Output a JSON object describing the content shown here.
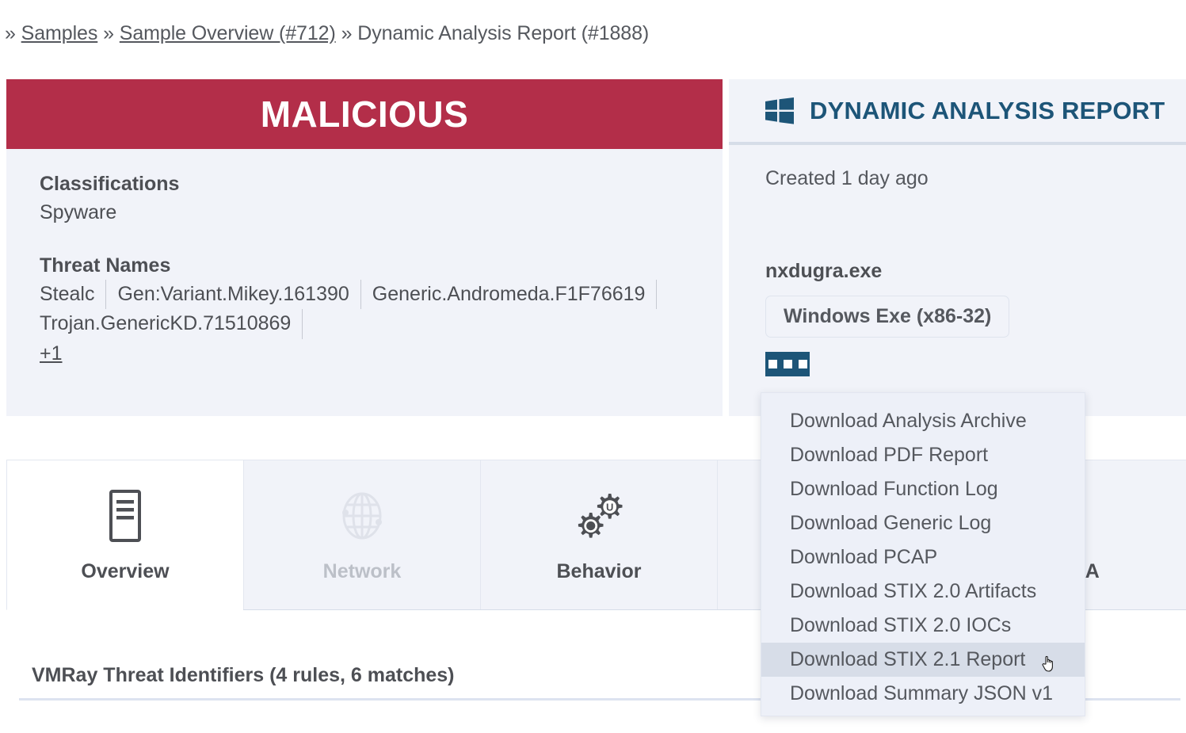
{
  "breadcrumb": {
    "separator": "»",
    "items": [
      {
        "label": "Samples",
        "link": true
      },
      {
        "label": "Sample Overview (#712)",
        "link": true
      },
      {
        "label": "Dynamic Analysis Report (#1888)",
        "link": false
      }
    ]
  },
  "verdict": {
    "banner": "MALICIOUS",
    "banner_color": "#b32e49",
    "classifications_label": "Classifications",
    "classifications_value": "Spyware",
    "threat_names_label": "Threat Names",
    "threat_names": [
      "Stealc",
      "Gen:Variant.Mikey.161390",
      "Generic.Andromeda.F1F76619",
      "Trojan.GenericKD.71510869"
    ],
    "threat_names_more": "+1"
  },
  "report": {
    "icon": "windows-logo-icon",
    "title": "DYNAMIC ANALYSIS REPORT",
    "title_color": "#1d5578",
    "created": "Created 1 day ago",
    "file_name": "nxdugra.exe",
    "file_type_badge": "Windows Exe (x86-32)",
    "more_button": "more-actions-icon"
  },
  "dropdown": {
    "open": true,
    "active_index": 7,
    "items": [
      "Download Analysis Archive",
      "Download PDF Report",
      "Download Function Log",
      "Download Generic Log",
      "Download PCAP",
      "Download STIX 2.0 Artifacts",
      "Download STIX 2.0 IOCs",
      "Download STIX 2.1 Report",
      "Download Summary JSON v1"
    ]
  },
  "tabs": {
    "active_index": 0,
    "items": [
      {
        "label": "Overview",
        "icon": "document-icon",
        "state": "active"
      },
      {
        "label": "Network",
        "icon": "globe-icon",
        "state": "disabled"
      },
      {
        "label": "Behavior",
        "icon": "gears-icon",
        "state": "enabled"
      },
      {
        "label": "",
        "icon": "",
        "state": "enabled"
      },
      {
        "label": "YARA",
        "icon": "circle-icon",
        "state": "enabled"
      }
    ]
  },
  "main": {
    "section_title": "VMRay Threat Identifiers (4 rules, 6 matches)"
  }
}
